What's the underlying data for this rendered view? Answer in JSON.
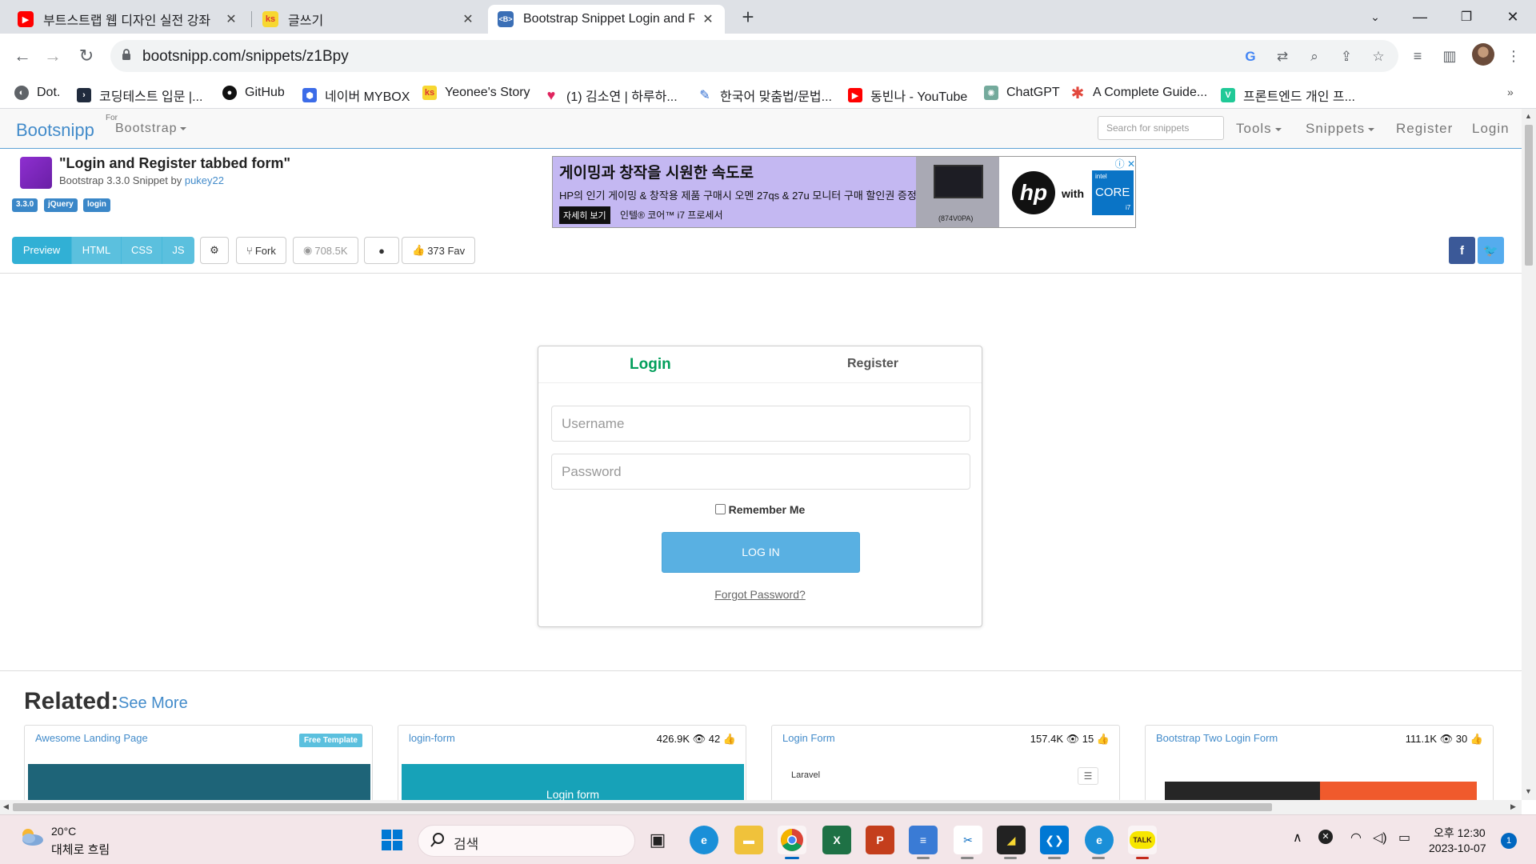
{
  "browser": {
    "tabs": [
      {
        "title": "부트스트랩 웹 디자인 실전 강좌",
        "favicon": "youtube-icon",
        "color": "#ff0000"
      },
      {
        "title": "글쓰기",
        "favicon": "tistory-icon",
        "color": "#f7d731"
      },
      {
        "title": "Bootstrap Snippet Login and Re",
        "favicon": "bootsnipp-icon",
        "color": "#3b6fb6"
      }
    ],
    "url": "bootsnipp.com/snippets/z1Bpy",
    "bookmarks": [
      {
        "label": "Dot.",
        "icon": "globe-icon",
        "color": "#5f6368"
      },
      {
        "label": "코딩테스트 입문 |...",
        "icon": "programmers-icon",
        "color": "#202b3d"
      },
      {
        "label": "GitHub",
        "icon": "github-icon",
        "color": "#111111"
      },
      {
        "label": "네이버 MYBOX",
        "icon": "mybox-icon",
        "color": "#3c6ce8"
      },
      {
        "label": "Yeonee's Story",
        "icon": "tistory-icon",
        "color": "#f7d731"
      },
      {
        "label": "(1) 김소연 | 하루하...",
        "icon": "heart-icon",
        "color": "#e0245e"
      },
      {
        "label": "한국어 맞춤법/문법...",
        "icon": "spell-icon",
        "color": "#2d6bd1"
      },
      {
        "label": "동빈나 - YouTube",
        "icon": "youtube-icon",
        "color": "#ff0000"
      },
      {
        "label": "ChatGPT",
        "icon": "chatgpt-icon",
        "color": "#74aa9c"
      },
      {
        "label": "A Complete Guide...",
        "icon": "asterisk-icon",
        "color": "#e2483d"
      },
      {
        "label": "프론트엔드 개인 프...",
        "icon": "velog-icon",
        "color": "#20c997"
      }
    ]
  },
  "site": {
    "brand": "Bootsnipp",
    "for_label": "For",
    "framework": "Bootstrap",
    "search_placeholder": "Search for snippets",
    "nav": {
      "tools": "Tools",
      "snippets": "Snippets",
      "register": "Register",
      "login": "Login"
    }
  },
  "snippet": {
    "title": "\"Login and Register tabbed form\"",
    "subtitle_prefix": "Bootstrap 3.3.0 Snippet by",
    "author": "pukey22",
    "tags": [
      "3.3.0",
      "jQuery",
      "login"
    ],
    "view_tabs": [
      "Preview",
      "HTML",
      "CSS",
      "JS"
    ],
    "fork_label": "Fork",
    "views": "708.5K",
    "favs": "373 Fav",
    "social": {
      "facebook": "f",
      "twitter": "t"
    }
  },
  "ad": {
    "headline": "게이밍과 창작을 시원한 속도로",
    "body": "HP의 인기 게이밍 & 창작용 제품 구매시 오멘 27qs & 27u 모니터 구매 할인권 증정",
    "cta": "자세히 보기",
    "processor": "인텔® 코어™ i7 프로세서",
    "model": "(874V0PA)",
    "brand": "hp",
    "with": "with",
    "intel": "intel",
    "core": "CORE",
    "tier": "i7"
  },
  "login_form": {
    "tab_login": "Login",
    "tab_register": "Register",
    "username_placeholder": "Username",
    "password_placeholder": "Password",
    "remember": "Remember Me",
    "submit": "LOG IN",
    "forgot": "Forgot Password?"
  },
  "related": {
    "title": "Related:",
    "see_more": "See More",
    "cards": [
      {
        "name": "Awesome Landing Page",
        "badge": "Free Template"
      },
      {
        "name": "login-form",
        "stats": "426.9K 👁 42 👍",
        "thumb_text": "Login form"
      },
      {
        "name": "Login Form",
        "stats": "157.4K 👁 15 👍",
        "thumb_text": "Laravel"
      },
      {
        "name": "Bootstrap Two Login Form",
        "stats": "111.1K 👁 30 👍"
      }
    ]
  },
  "taskbar": {
    "temperature": "20°C",
    "weather": "대체로 흐림",
    "search": "검색",
    "time": "오후 12:30",
    "date": "2023-10-07",
    "notifications": "1"
  }
}
